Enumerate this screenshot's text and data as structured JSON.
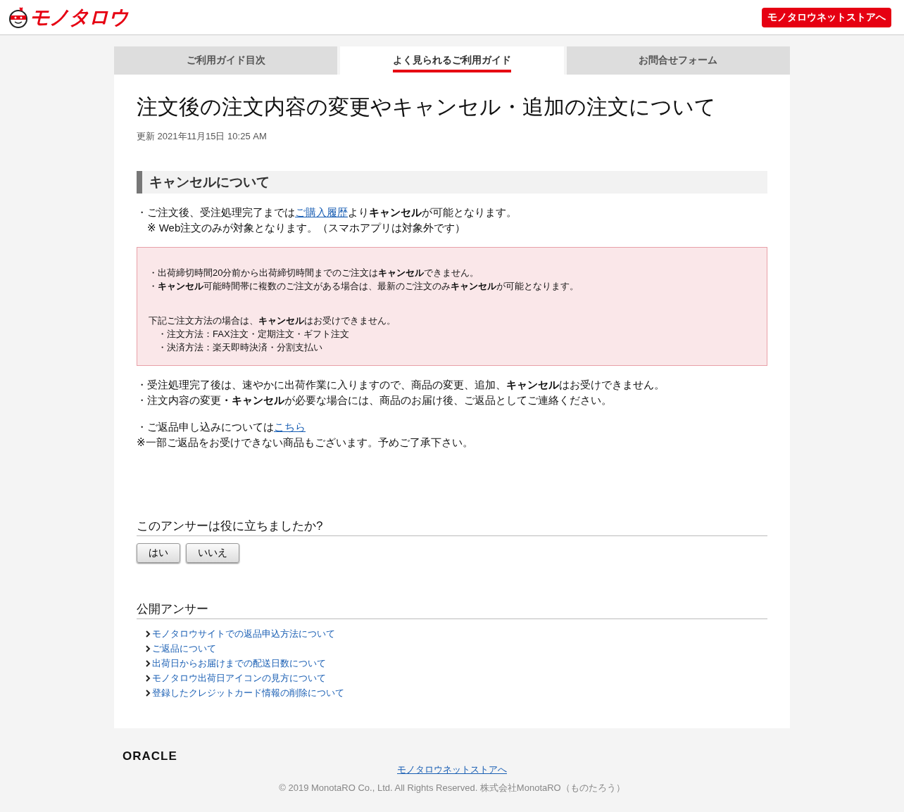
{
  "header": {
    "logo": "モノタロウ",
    "store_button": "モノタロウネットストアへ"
  },
  "tabs": [
    {
      "label": "ご利用ガイド目次",
      "selected": false
    },
    {
      "label": "よく見られるご利用ガイド",
      "selected": true
    },
    {
      "label": "お問合せフォーム",
      "selected": false
    }
  ],
  "article": {
    "title": "注文後の注文内容の変更やキャンセル・追加の注文について",
    "updated": "更新 2021年11月15日 10:25 AM",
    "section_heading": "キャンセルについて",
    "intro": [
      [
        {
          "kind": "text",
          "text": "・ご注文後、受注処理完了までは"
        },
        {
          "kind": "link",
          "text": "ご購入履歴"
        },
        {
          "kind": "text",
          "text": "より**キャンセル**が可能となります。"
        }
      ],
      [
        {
          "kind": "text",
          "text": "　※ Web注文のみが対象となります。（スマホアプリは対象外です）"
        }
      ]
    ],
    "notice": {
      "groups": [
        [
          "・出荷締切時間20分前から出荷締切時間までのご注文は**キャンセル**できません。",
          "・**キャンセル**可能時間帯に複数のご注文がある場合は、最新のご注文のみ**キャンセル**が可能となります。"
        ],
        [
          "下記ご注文方法の場合は、**キャンセル**はお受けできません。",
          "　・注文方法：FAX注文・定期注文・ギフト注文",
          "　・決済方法：楽天即時決済・分割支払い"
        ]
      ]
    },
    "after": [
      [
        [
          {
            "kind": "text",
            "text": "・受注処理完了後は、速やかに出荷作業に入りますので、商品の変更、追加、**キャンセル**はお受けできません。"
          }
        ],
        [
          {
            "kind": "text",
            "text": "・注文内容の変更**・キャンセル**が必要な場合には、商品のお届け後、ご返品としてご連絡ください。"
          }
        ]
      ],
      [
        [
          {
            "kind": "text",
            "text": "・ご返品申し込みについては"
          },
          {
            "kind": "link",
            "text": "こちら"
          }
        ],
        [
          {
            "kind": "text",
            "text": "※一部ご返品をお受けできない商品もございます。予めご了承下さい。"
          }
        ]
      ]
    ]
  },
  "feedback": {
    "question": "このアンサーは役に立ちましたか?",
    "buttons": [
      "はい",
      "いいえ"
    ]
  },
  "public_answers": {
    "heading": "公開アンサー",
    "links": [
      "モノタロウサイトでの返品申込方法について",
      "ご返品について",
      "出荷日からお届けまでの配送日数について",
      "モノタロウ出荷日アイコンの見方について",
      "登録したクレジットカード情報の削除について"
    ]
  },
  "footer": {
    "vendor_logo": "ORACLE",
    "store_link": "モノタロウネットストアへ",
    "copyright": "© 2019 MonotaRO Co., Ltd. All Rights Reserved. 株式会社MonotaRO（ものたろう）"
  }
}
